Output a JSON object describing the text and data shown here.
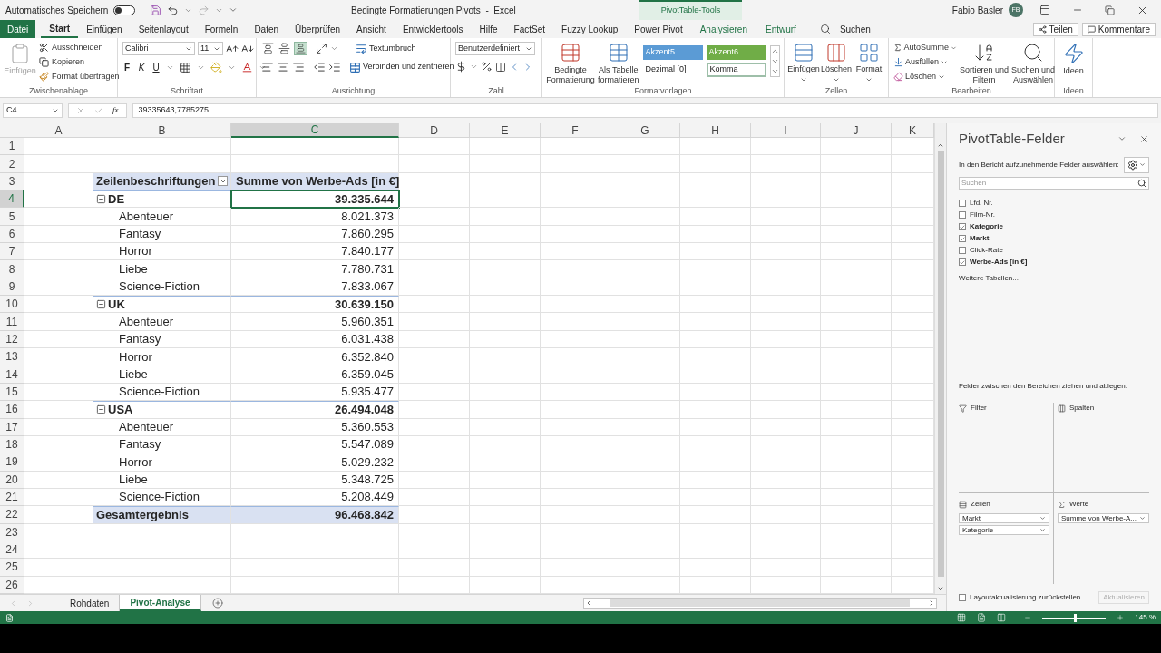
{
  "title_bar": {
    "autosave_label": "Automatisches Speichern",
    "autosave_on": false,
    "title": "Bedingte Formatierungen Pivots  -  Excel",
    "context_label": "PivotTable-Tools",
    "user": "Fabio Basler",
    "initials": "FB"
  },
  "tabs": [
    {
      "label": "Datei",
      "kind": "file",
      "selected": false
    },
    {
      "label": "Start",
      "kind": "normal",
      "selected": true
    },
    {
      "label": "Einfügen",
      "kind": "normal",
      "selected": false
    },
    {
      "label": "Seitenlayout",
      "kind": "normal",
      "selected": false
    },
    {
      "label": "Formeln",
      "kind": "normal",
      "selected": false
    },
    {
      "label": "Daten",
      "kind": "normal",
      "selected": false
    },
    {
      "label": "Überprüfen",
      "kind": "normal",
      "selected": false
    },
    {
      "label": "Ansicht",
      "kind": "normal",
      "selected": false
    },
    {
      "label": "Entwicklertools",
      "kind": "normal",
      "selected": false
    },
    {
      "label": "Hilfe",
      "kind": "normal",
      "selected": false
    },
    {
      "label": "FactSet",
      "kind": "normal",
      "selected": false
    },
    {
      "label": "Fuzzy Lookup",
      "kind": "normal",
      "selected": false
    },
    {
      "label": "Power Pivot",
      "kind": "normal",
      "selected": false
    },
    {
      "label": "Analysieren",
      "kind": "contextual",
      "selected": false
    },
    {
      "label": "Entwurf",
      "kind": "contextual",
      "selected": false
    }
  ],
  "search": "Suchen",
  "share": "Teilen",
  "comments": "Kommentare",
  "ribbon": {
    "groups": [
      {
        "kind": "clipboard",
        "label": "Zwischenablage",
        "paste": "Einfügen",
        "paste_disabled": true,
        "commands": [
          "Ausschneiden",
          "Kopieren",
          "Format übertragen"
        ]
      },
      {
        "kind": "font",
        "label": "Schriftart",
        "font": "Calibri",
        "size": "11",
        "styles": [
          "F",
          "K",
          "U"
        ]
      },
      {
        "kind": "alignment",
        "label": "Ausrichtung",
        "vertical": [
          {
            "selected": false
          },
          {
            "selected": false
          },
          {
            "selected": true
          }
        ],
        "wrap": "Textumbruch",
        "merge": "Verbinden und zentrieren"
      },
      {
        "kind": "number",
        "label": "Zahl",
        "format": "Benutzerdefiniert"
      },
      {
        "kind": "styles",
        "label": "Formatvorlagen",
        "buttons": [
          {
            "lines": [
              "Bedingte",
              "Formatierung"
            ]
          },
          {
            "lines": [
              "Als Tabelle",
              "formatieren"
            ]
          }
        ],
        "cell_styles": [
          {
            "label": "Akzent5",
            "color": "#5b9bd5",
            "selected": false
          },
          {
            "label": "Akzent6",
            "color": "#70ad47",
            "selected": false
          },
          {
            "label": "Dezimal [0]",
            "selected": false
          },
          {
            "label": "Komma",
            "selected": true
          }
        ]
      },
      {
        "kind": "cells",
        "label": "Zellen",
        "buttons": [
          "Einfügen",
          "Löschen",
          "Format"
        ]
      },
      {
        "kind": "editing",
        "label": "Bearbeiten",
        "commands": [
          "AutoSumme",
          "Ausfüllen",
          "Löschen"
        ],
        "buttons": [
          {
            "lines": [
              "Sortieren und",
              "Filtern"
            ]
          },
          {
            "lines": [
              "Suchen und",
              "Auswählen"
            ]
          }
        ]
      },
      {
        "kind": "ideas",
        "label": "Ideen",
        "button": "Ideen"
      }
    ]
  },
  "formula_bar": {
    "name_box": "C4",
    "insert_function": "fx",
    "formula": "39335643,7785275"
  },
  "columns": [
    {
      "label": "A",
      "selected": false
    },
    {
      "label": "B",
      "selected": false
    },
    {
      "label": "C",
      "selected": true
    },
    {
      "label": "D",
      "selected": false
    },
    {
      "label": "E",
      "selected": false
    },
    {
      "label": "F",
      "selected": false
    },
    {
      "label": "G",
      "selected": false
    },
    {
      "label": "H",
      "selected": false
    },
    {
      "label": "I",
      "selected": false
    },
    {
      "label": "J",
      "selected": false
    },
    {
      "label": "K",
      "selected": false
    }
  ],
  "rows": [
    {
      "number": "1",
      "kind": "empty",
      "selected": false
    },
    {
      "number": "2",
      "kind": "empty",
      "selected": false
    },
    {
      "number": "3",
      "kind": "header",
      "selected": false,
      "label": "Zeilenbeschriftungen",
      "value": "Summe von Werbe-Ads [in €]"
    },
    {
      "number": "4",
      "kind": "group",
      "selected": true,
      "expanded": true,
      "label": "DE",
      "value": "39.335.644"
    },
    {
      "number": "5",
      "kind": "item",
      "selected": false,
      "label": "Abenteuer",
      "value": "8.021.373"
    },
    {
      "number": "6",
      "kind": "item",
      "selected": false,
      "label": "Fantasy",
      "value": "7.860.295"
    },
    {
      "number": "7",
      "kind": "item",
      "selected": false,
      "label": "Horror",
      "value": "7.840.177"
    },
    {
      "number": "8",
      "kind": "item",
      "selected": false,
      "label": "Liebe",
      "value": "7.780.731"
    },
    {
      "number": "9",
      "kind": "item",
      "selected": false,
      "label": "Science-Fiction",
      "value": "7.833.067"
    },
    {
      "number": "10",
      "kind": "group",
      "selected": false,
      "expanded": true,
      "label": "UK",
      "value": "30.639.150"
    },
    {
      "number": "11",
      "kind": "item",
      "selected": false,
      "label": "Abenteuer",
      "value": "5.960.351"
    },
    {
      "number": "12",
      "kind": "item",
      "selected": false,
      "label": "Fantasy",
      "value": "6.031.438"
    },
    {
      "number": "13",
      "kind": "item",
      "selected": false,
      "label": "Horror",
      "value": "6.352.840"
    },
    {
      "number": "14",
      "kind": "item",
      "selected": false,
      "label": "Liebe",
      "value": "6.359.045"
    },
    {
      "number": "15",
      "kind": "item",
      "selected": false,
      "label": "Science-Fiction",
      "value": "5.935.477"
    },
    {
      "number": "16",
      "kind": "group",
      "selected": false,
      "expanded": true,
      "label": "USA",
      "value": "26.494.048"
    },
    {
      "number": "17",
      "kind": "item",
      "selected": false,
      "label": "Abenteuer",
      "value": "5.360.553"
    },
    {
      "number": "18",
      "kind": "item",
      "selected": false,
      "label": "Fantasy",
      "value": "5.547.089"
    },
    {
      "number": "19",
      "kind": "item",
      "selected": false,
      "label": "Horror",
      "value": "5.029.232"
    },
    {
      "number": "20",
      "kind": "item",
      "selected": false,
      "label": "Liebe",
      "value": "5.348.725"
    },
    {
      "number": "21",
      "kind": "item",
      "selected": false,
      "label": "Science-Fiction",
      "value": "5.208.449"
    },
    {
      "number": "22",
      "kind": "total",
      "selected": false,
      "label": "Gesamtergebnis",
      "value": "96.468.842"
    },
    {
      "number": "23",
      "kind": "empty",
      "selected": false
    },
    {
      "number": "24",
      "kind": "empty",
      "selected": false
    },
    {
      "number": "25",
      "kind": "empty",
      "selected": false
    },
    {
      "number": "26",
      "kind": "empty",
      "selected": false
    }
  ],
  "sheet_tabs": [
    {
      "label": "Rohdaten",
      "selected": false
    },
    {
      "label": "Pivot-Analyse",
      "selected": true
    }
  ],
  "pivot_pane": {
    "title": "PivotTable-Felder",
    "subtitle": "In den Bericht aufzunehmende Felder auswählen:",
    "search_placeholder": "Suchen",
    "fields": [
      {
        "label": "Lfd. Nr.",
        "checked": false
      },
      {
        "label": "Film-Nr.",
        "checked": false
      },
      {
        "label": "Kategorie",
        "checked": true
      },
      {
        "label": "Markt",
        "checked": true
      },
      {
        "label": "Click-Rate",
        "checked": false
      },
      {
        "label": "Werbe-Ads [in €]",
        "checked": true
      }
    ],
    "more_tables": "Weitere Tabellen...",
    "areas_hint": "Felder zwischen den Bereichen ziehen und ablegen:",
    "areas": [
      {
        "kind": "filter",
        "label": "Filter"
      },
      {
        "kind": "columns",
        "label": "Spalten"
      },
      {
        "kind": "rows",
        "label": "Zeilen",
        "fields": [
          "Markt",
          "Kategorie"
        ]
      },
      {
        "kind": "values",
        "label": "Werte",
        "fields": [
          "Summe von Werbe-A..."
        ]
      }
    ],
    "defer_label": "Layoutaktualisierung zurückstellen",
    "defer_checked": false,
    "update": "Aktualisieren",
    "update_disabled": true
  },
  "status_bar": {
    "zoom": {
      "label": "145 %",
      "level": 0.5
    }
  }
}
